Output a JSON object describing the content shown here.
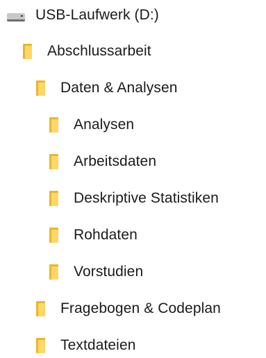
{
  "tree": {
    "drive": {
      "label": "USB-Laufwerk (D:)",
      "icon": "usb-drive-icon"
    },
    "items": [
      {
        "label": "Abschlussarbeit",
        "icon": "folder-icon",
        "level": 1
      },
      {
        "label": "Daten & Analysen",
        "icon": "folder-icon",
        "level": 2
      },
      {
        "label": "Analysen",
        "icon": "folder-icon",
        "level": 3
      },
      {
        "label": "Arbeitsdaten",
        "icon": "folder-icon",
        "level": 3
      },
      {
        "label": "Deskriptive Statistiken",
        "icon": "folder-icon",
        "level": 3
      },
      {
        "label": "Rohdaten",
        "icon": "folder-icon",
        "level": 3
      },
      {
        "label": "Vorstudien",
        "icon": "folder-icon",
        "level": 3
      },
      {
        "label": "Fragebogen & Codeplan",
        "icon": "folder-icon",
        "level": 2
      },
      {
        "label": "Textdateien",
        "icon": "folder-icon",
        "level": 2
      }
    ],
    "colors": {
      "folder_front": "#ffd766",
      "folder_back": "#e8b730",
      "text": "#1a1a1a"
    }
  }
}
